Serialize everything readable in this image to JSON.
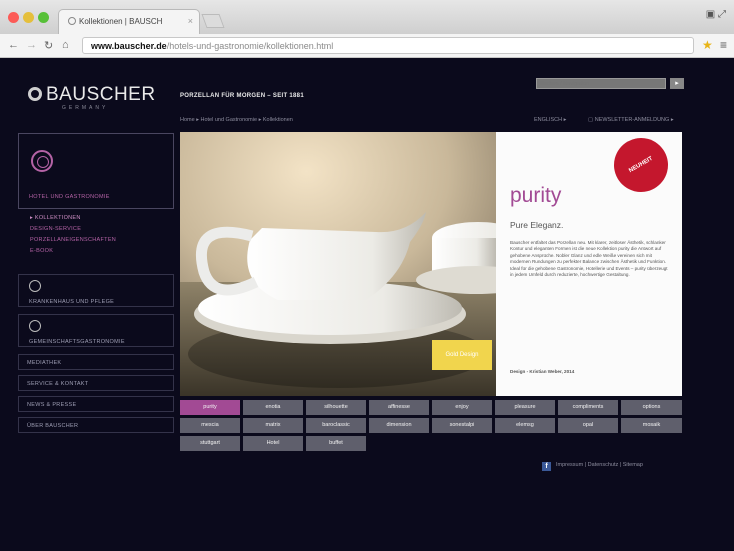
{
  "browser": {
    "tab_title": "Kollektionen | BAUSCH",
    "tab_close": "×",
    "url_domain": "www.bauscher.de",
    "url_path": "/hotels-und-gastronomie/kollektionen.html",
    "window_controls": "▣ ⤢"
  },
  "site": {
    "logo": "BAUSCHER",
    "logo_sub": "GERMANY",
    "tagline": "PORZELLAN FÜR MORGEN – SEIT 1881",
    "search_placeholder": "Suchen / Navigation",
    "search_button": "▸",
    "breadcrumb": "Home  ▸  Hotel und Gastronomie  ▸  Kollektionen",
    "language": "ENGLISCH ▸",
    "newsletter": "▢  NEWSLETTER-ANMELDUNG ▸"
  },
  "sidebar": {
    "hotel_label": "HOTEL UND GASTRONOMIE",
    "submenu": [
      "▸  KOLLEKTIONEN",
      "DESIGN-SERVICE",
      "PORZELLANEIGENSCHAFTEN",
      "E-BOOK"
    ],
    "kh_label": "KRANKENHAUS UND PFLEGE",
    "gg_label": "GEMEINSCHAFTSGASTRONOMIE",
    "items": [
      "MEDIATHEK",
      "SERVICE & KONTAKT",
      "NEWS & PRESSE",
      "ÜBER BAUSCHER"
    ]
  },
  "hero": {
    "badge": "NEUHEIT",
    "title": "purity",
    "subtitle": "Pure Eleganz.",
    "description": "Bauscher entfaltet das Porzellan neu. Mit klarer, zeitloser Ästhetik, schlanker Kontur und eleganten Formen ist die neue Kollektion purity die Antwort auf gehobene Ansprüche. Nobler Glanz und edle Weiße vereinen sich mit modernen Rundungen zu perfekter Balance zwischen Ästhetik und Funktion. Ideal für die gehobene Gastronomie, Hotellerie und Events – purity überzeugt in jedem Umfeld durch reduzierte, hochwertige Gestaltung.",
    "design_credit": "Design - Kristian Weber, 2014",
    "award": "Gold Design"
  },
  "collections": [
    [
      "purity",
      "enotia",
      "silhouette",
      "affinesse",
      "enjoy",
      "pleasure",
      "compliments",
      "options"
    ],
    [
      "mescia",
      "matrix",
      "baroclassic",
      "dimension",
      "sonestalpi",
      "elemsg",
      "opal",
      "mosaik"
    ],
    [
      "stuttgart",
      "Hotel",
      "buffet"
    ]
  ],
  "active_collection": "purity",
  "footer": {
    "fb_icon": "f",
    "links": "Impressum | Datenschutz | Sitemap"
  },
  "colors": {
    "background": "#0b0a1c",
    "accent": "#a24a94",
    "grid_cell": "#5f5f6c",
    "badge": "#c4172d"
  }
}
